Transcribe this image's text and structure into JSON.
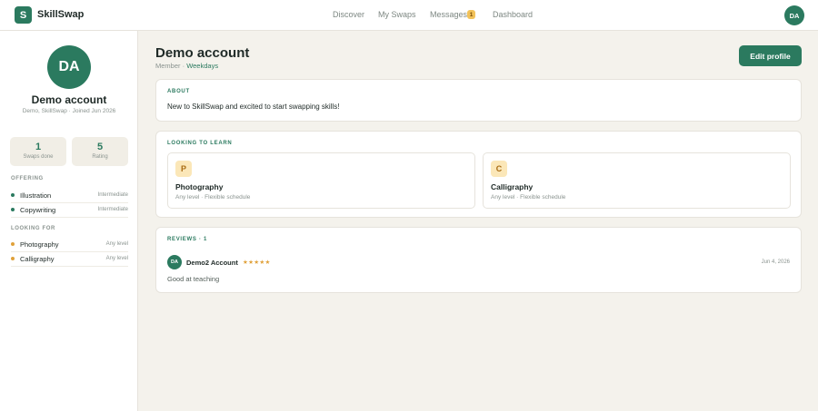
{
  "header": {
    "logo_letter": "S",
    "brand": "SkillSwap",
    "nav": [
      "Discover",
      "My Swaps",
      "Messages",
      "Dashboard"
    ],
    "messages_badge": "1",
    "user_initials": "DA"
  },
  "sidebar": {
    "initials": "DA",
    "name": "Demo account",
    "meta": "Demo, SkillSwap · Joined Jun 2026",
    "stats": [
      {
        "value": "1",
        "label": "Swaps done"
      },
      {
        "value": "5",
        "label": "Rating"
      }
    ],
    "offering_title": "OFFERING",
    "offering": [
      {
        "name": "Illustration",
        "level": "Intermediate"
      },
      {
        "name": "Copywriting",
        "level": "Intermediate"
      }
    ],
    "looking_title": "LOOKING FOR",
    "looking": [
      {
        "name": "Photography",
        "level": "Any level"
      },
      {
        "name": "Calligraphy",
        "level": "Any level"
      }
    ]
  },
  "main": {
    "title": "Demo account",
    "role": "Member",
    "availability": "Weekdays",
    "edit_label": "Edit profile",
    "about": {
      "label": "ABOUT",
      "text": "New to SkillSwap and excited to start swapping skills!"
    },
    "learn": {
      "label": "LOOKING TO LEARN",
      "items": [
        {
          "letter": "P",
          "name": "Photography",
          "meta": "Any level · Flexible schedule"
        },
        {
          "letter": "C",
          "name": "Calligraphy",
          "meta": "Any level · Flexible schedule"
        }
      ]
    },
    "reviews": {
      "label": "REVIEWS · 1",
      "items": [
        {
          "initials": "DA",
          "name": "Demo2 Account",
          "stars": "★★★★★",
          "rating": 5,
          "date": "Jun 4, 2026",
          "text": "Good at teaching"
        }
      ]
    }
  },
  "colors": {
    "accent": "#2b7a5f",
    "badge": "#f2c25a",
    "background": "#f4f2ec",
    "dot_offering": "#2b7a5f",
    "dot_looking": "#e0a13a"
  }
}
